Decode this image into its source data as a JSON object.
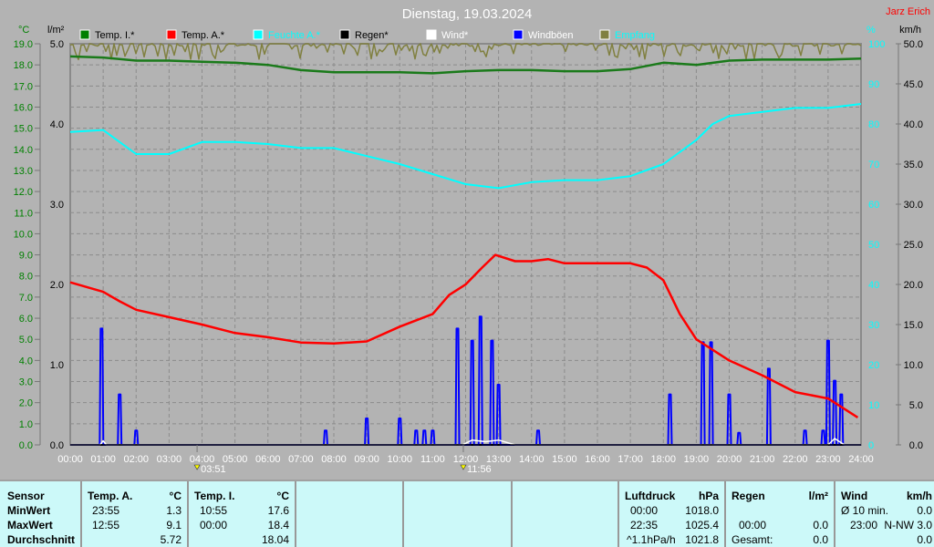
{
  "chart_data": {
    "type": "line",
    "title": "Dienstag, 19.03.2024",
    "author": "Jarz Erich",
    "axes": {
      "left_temp": {
        "unit": "°C",
        "range": [
          0,
          19
        ],
        "ticks": [
          "0.0",
          "1.0",
          "2.0",
          "3.0",
          "4.0",
          "5.0",
          "6.0",
          "7.0",
          "8.0",
          "9.0",
          "10.0",
          "11.0",
          "12.0",
          "13.0",
          "14.0",
          "15.0",
          "16.0",
          "17.0",
          "18.0",
          "19.0"
        ]
      },
      "left_rain": {
        "unit": "l/m²",
        "range": [
          0,
          5
        ],
        "ticks": [
          "0.0",
          "1.0",
          "2.0",
          "3.0",
          "4.0",
          "5.0"
        ]
      },
      "right_humidity": {
        "unit": "%",
        "range": [
          0,
          100
        ],
        "ticks": [
          "0",
          "10",
          "20",
          "30",
          "40",
          "50",
          "60",
          "70",
          "80",
          "90",
          "100"
        ]
      },
      "right_wind": {
        "unit": "km/h",
        "range": [
          0,
          50
        ],
        "ticks": [
          "0.0",
          "5.0",
          "10.0",
          "15.0",
          "20.0",
          "25.0",
          "30.0",
          "35.0",
          "40.0",
          "45.0",
          "50.0"
        ]
      },
      "x": {
        "range": [
          0,
          24
        ],
        "ticks": [
          "00:00",
          "01:00",
          "02:00",
          "03:00",
          "04:00",
          "05:00",
          "06:00",
          "07:00",
          "08:00",
          "09:00",
          "10:00",
          "11:00",
          "12:00",
          "13:00",
          "14:00",
          "15:00",
          "16:00",
          "17:00",
          "18:00",
          "19:00",
          "20:00",
          "21:00",
          "22:00",
          "23:00",
          "24:00"
        ]
      }
    },
    "legend": [
      {
        "label": "Temp. I.*",
        "color": "#008000",
        "text_color": "#000000"
      },
      {
        "label": "Temp. A.*",
        "color": "#ff0000",
        "text_color": "#000000"
      },
      {
        "label": "Feuchte A.*",
        "color": "#00ffff",
        "text_color": "#00ffff"
      },
      {
        "label": "Regen*",
        "color": "#000000",
        "text_color": "#000000"
      },
      {
        "label": "Wind*",
        "color": "#ffffff",
        "text_color": "#ffffff"
      },
      {
        "label": "Windböen",
        "color": "#0000ff",
        "text_color": "#ffffff"
      },
      {
        "label": "Empfang",
        "color": "#808040",
        "text_color": "#00ffff"
      }
    ],
    "series": [
      {
        "name": "Temp. I.",
        "axis": "left_temp",
        "color": "#1a7a1a",
        "x": [
          0,
          1,
          2,
          3,
          4,
          5,
          6,
          7,
          8,
          9,
          10,
          11,
          12,
          13,
          14,
          15,
          16,
          17,
          18,
          19,
          20,
          21,
          22,
          23,
          24
        ],
        "y": [
          18.4,
          18.35,
          18.2,
          18.2,
          18.15,
          18.1,
          18.0,
          17.75,
          17.65,
          17.65,
          17.65,
          17.6,
          17.7,
          17.75,
          17.75,
          17.7,
          17.7,
          17.8,
          18.1,
          18.0,
          18.2,
          18.25,
          18.25,
          18.25,
          18.3
        ]
      },
      {
        "name": "Temp. A.",
        "axis": "left_temp",
        "color": "#ff0000",
        "x": [
          0,
          1,
          1.5,
          2,
          3,
          4,
          5,
          6,
          7,
          8,
          9,
          10,
          11,
          11.5,
          12,
          12.5,
          12.9,
          13.5,
          14,
          14.5,
          15,
          16,
          17,
          17.5,
          18,
          18.5,
          19,
          20,
          21,
          22,
          23,
          23.9
        ],
        "y": [
          7.7,
          7.25,
          6.8,
          6.4,
          6.05,
          5.7,
          5.3,
          5.1,
          4.85,
          4.8,
          4.9,
          5.6,
          6.2,
          7.1,
          7.6,
          8.4,
          9.0,
          8.7,
          8.7,
          8.8,
          8.6,
          8.6,
          8.6,
          8.4,
          7.8,
          6.2,
          5.0,
          4.0,
          3.3,
          2.5,
          2.2,
          1.3
        ]
      },
      {
        "name": "Feuchte A.",
        "axis": "right_humidity",
        "color": "#00ffff",
        "x": [
          0,
          1,
          2,
          3,
          4,
          5,
          6,
          7,
          8,
          9,
          10,
          11,
          12,
          13,
          14,
          15,
          16,
          17,
          18,
          19,
          19.5,
          20,
          21,
          22,
          23,
          24
        ],
        "y": [
          78,
          78.5,
          72.5,
          72.5,
          75.5,
          75.5,
          75,
          74,
          74,
          72,
          70,
          67.5,
          65,
          64,
          65.5,
          66,
          66,
          67,
          70,
          76,
          80,
          82,
          83,
          84,
          84,
          85
        ]
      },
      {
        "name": "Windböen",
        "axis": "right_wind",
        "color": "#0000ff",
        "type": "spikes",
        "x": [
          0.95,
          1.5,
          2.0,
          7.75,
          9.0,
          10.0,
          10.5,
          10.75,
          11.0,
          11.75,
          12.2,
          12.45,
          12.8,
          13.0,
          14.2,
          18.2,
          19.2,
          19.45,
          20.0,
          20.3,
          21.2,
          22.3,
          22.85,
          23.0,
          23.2,
          23.4
        ],
        "y": [
          14.5,
          6.3,
          1.8,
          1.8,
          3.3,
          3.3,
          1.8,
          1.8,
          1.8,
          14.5,
          13.0,
          16.0,
          13.0,
          7.5,
          1.8,
          6.3,
          12.8,
          12.8,
          6.3,
          1.5,
          9.5,
          1.8,
          1.8,
          13.0,
          8.0,
          6.3
        ]
      },
      {
        "name": "Regen",
        "axis": "left_rain",
        "color": "#000000",
        "x": [
          0,
          24
        ],
        "y": [
          0,
          0
        ]
      },
      {
        "name": "Wind",
        "axis": "right_wind",
        "color": "#ffffff",
        "x": [
          0,
          0.9,
          1.0,
          1.1,
          11.9,
          12.2,
          12.6,
          13.0,
          13.5,
          23.0,
          23.2,
          23.5,
          24
        ],
        "y": [
          0,
          0,
          0.5,
          0,
          0,
          0.6,
          0.4,
          0.6,
          0,
          0,
          0.8,
          0,
          0
        ]
      },
      {
        "name": "Empfang",
        "axis": "right_humidity",
        "color": "#808040",
        "type": "noisy",
        "base": 99,
        "x": [
          0,
          24
        ],
        "y": [
          99,
          99
        ]
      }
    ],
    "annotations": [
      {
        "label": "03:51",
        "x": 3.85,
        "icon": "sunrise-icon"
      },
      {
        "label": "11:56",
        "x": 11.93,
        "icon": "sun-noon-icon"
      }
    ]
  },
  "panel": {
    "sensor": {
      "header": "Sensor",
      "rows": [
        "MinWert",
        "MaxWert",
        "Durchschnitt"
      ]
    },
    "temp_a": {
      "header": "Temp. A.",
      "unit": "°C",
      "min_time": "23:55",
      "min": "1.3",
      "max_time": "12:55",
      "max": "9.1",
      "avg": "5.72"
    },
    "temp_i": {
      "header": "Temp. I.",
      "unit": "°C",
      "min_time": "10:55",
      "min": "17.6",
      "max_time": "00:00",
      "max": "18.4",
      "avg": "18.04"
    },
    "pressure": {
      "header": "Luftdruck",
      "unit": "hPa",
      "min_time": "00:00",
      "min": "1018.0",
      "max_time": "22:35",
      "max": "1025.4",
      "trend": "^1.1hPa/h",
      "avg": "1021.8"
    },
    "rain": {
      "header": "Regen",
      "unit": "l/m²",
      "max_time": "00:00",
      "max": "0.0",
      "total_label": "Gesamt:",
      "total": "0.0"
    },
    "wind": {
      "header": "Wind",
      "unit": "km/h",
      "avg_label": "Ø 10 min.",
      "avg": "0.0",
      "max_time": "23:00",
      "max": "N-NW 3.0",
      "last": "0.0"
    }
  }
}
